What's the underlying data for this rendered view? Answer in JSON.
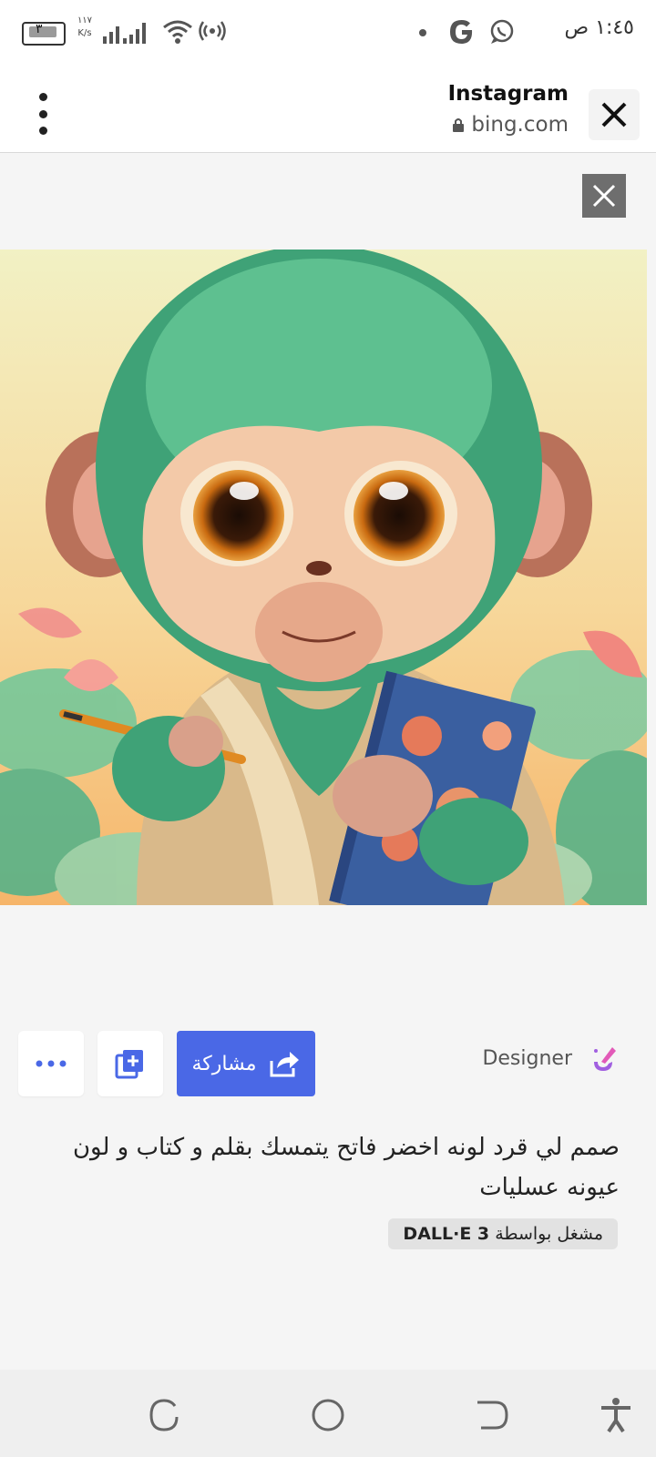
{
  "status_bar": {
    "time": "١:٤٥ ص",
    "speed_value": "١١٧",
    "speed_unit": "K/s",
    "battery": "٣"
  },
  "browser": {
    "title": "Instagram",
    "url": "bing.com"
  },
  "image": {
    "alt": "green monkey holding pencil and book"
  },
  "actions": {
    "share_label": "مشاركة",
    "designer_label": "Designer"
  },
  "prompt": {
    "text": "صمم لي قرد لونه اخضر فاتح يتمسك بقلم و كتاب و لون عيونه عسليات",
    "powered_prefix": "مشغل بواسطة",
    "powered_model": "DALL·E 3"
  },
  "colors": {
    "accent": "#4a68e6",
    "monkey_fur": "#3fa277",
    "background_top": "#f2f1c4",
    "background_bottom": "#f6b56a"
  }
}
